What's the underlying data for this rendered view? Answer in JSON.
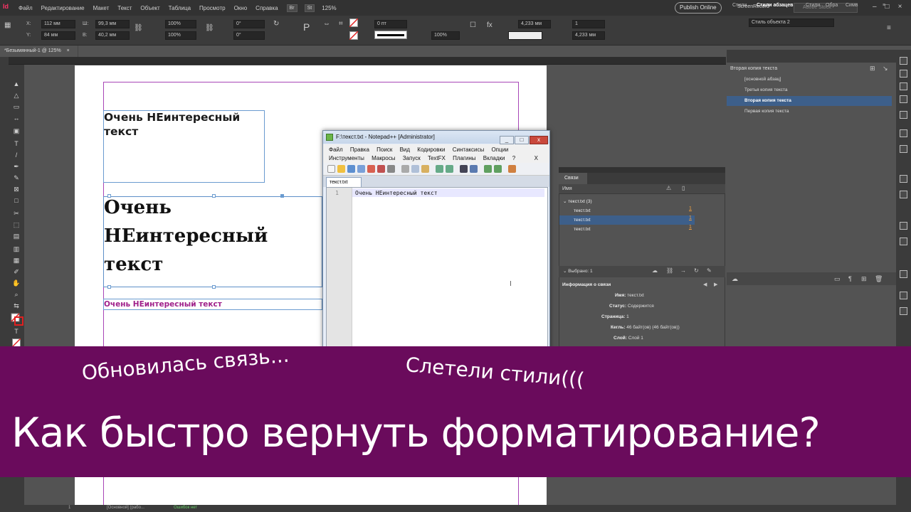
{
  "menubar": {
    "logo": "Id",
    "items": [
      "Файл",
      "Редактирование",
      "Макет",
      "Текст",
      "Объект",
      "Таблица",
      "Просмотр",
      "Окно",
      "Справка"
    ],
    "br_badge": "Br",
    "st_badge": "St",
    "zoom": "125%",
    "publish": "Publish Online",
    "screenrecord": "ScreenRecord",
    "stock_placeholder": "Adobe Stock",
    "window_controls": "–□×"
  },
  "control": {
    "x_label": "X:",
    "x_value": "112 мм",
    "y_label": "Y:",
    "y_value": "84 мм",
    "w_label": "Ш:",
    "w_value": "99,3 мм",
    "h_label": "В:",
    "h_value": "40,2 мм",
    "scale_x": "100%",
    "scale_y": "100%",
    "rot": "0°",
    "shear": "0°",
    "stroke_w": "0 пт",
    "opacity": "100%",
    "offset1": "4,233 мм",
    "offset2": "4,233 мм",
    "cols": "1",
    "obj_style": "Стиль объекта 2"
  },
  "document_tab": "*Безымянный-1 @ 125%",
  "page": {
    "text_small": "Очень НЕинтересный текст",
    "text_large": "Очень НЕинтересный текст",
    "text_pink": "Очень НЕинтересный текст"
  },
  "notepad": {
    "title": "F:\\текст.txt - Notepad++ [Administrator]",
    "menu_row1": [
      "Файл",
      "Правка",
      "Поиск",
      "Вид",
      "Кодировки",
      "Синтаксисы",
      "Опции"
    ],
    "menu_row2": [
      "Инструменты",
      "Макросы",
      "Запуск",
      "TextFX",
      "Плагины",
      "Вкладки",
      "?"
    ],
    "menu_close": "X",
    "tab": "текст.txt",
    "line_no": "1",
    "line_text": "Очень НЕинтересный текст",
    "win_min": "_",
    "win_max": "□",
    "win_close": "x"
  },
  "styles_panel": {
    "tabs": [
      "Стили",
      "Стили абзацев",
      "Стили",
      "Обра",
      "Симв"
    ],
    "current": "Вторая копия текста",
    "items": [
      "[основной абзац]",
      "Третья копия текста",
      "Вторая копия текста",
      "Первая копия текста"
    ],
    "selected_index": 2
  },
  "links_panel": {
    "tab": "Связи",
    "col_name": "Имя",
    "group": "текст.txt (3)",
    "rows": [
      "текст.txt",
      "текст.txt",
      "текст.txt"
    ],
    "row_nums": [
      "1",
      "1",
      "1"
    ],
    "selected_index": 1,
    "selected_label": "Выбрано: 1",
    "info_header": "Информация о связи",
    "info": [
      {
        "k": "Имя:",
        "v": "текст.txt"
      },
      {
        "k": "Статус:",
        "v": "Содержится"
      },
      {
        "k": "Страница:",
        "v": "1"
      },
      {
        "k": "Кегль:",
        "v": "46 байт(ов) (46 байт(ов))"
      },
      {
        "k": "Слой:",
        "v": "Слой 1"
      }
    ]
  },
  "status_bar": {
    "page": "1",
    "style": "[Основной] (рабо...",
    "errors": "Ошибок нет"
  },
  "banner": {
    "line1": "Обновилась связь...",
    "line2": "Слетели стили(((",
    "headline": "Как быстро вернуть форматирование?"
  },
  "colors": {
    "banner": "#6a0b5c",
    "selection": "#3d5f8a",
    "margin": "#a846b7",
    "frame": "#6a9bd0",
    "pink_text": "#a0208a"
  }
}
